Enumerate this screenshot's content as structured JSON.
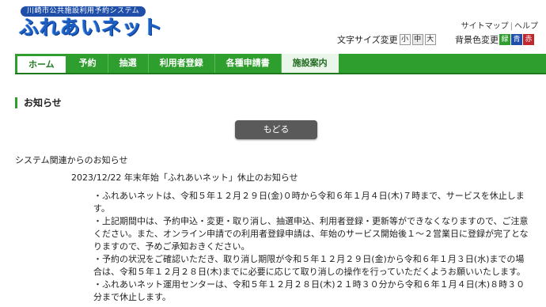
{
  "header": {
    "logo_subtitle": "川崎市公共施設利用予約システム",
    "logo_title": "ふれあいネット",
    "sitemap_link": "サイトマップ",
    "help_link": "ヘルプ",
    "fontsize_label": "文字サイズ変更",
    "fontsize_options": [
      "小",
      "中",
      "大"
    ],
    "bgcolor_label": "背景色変更",
    "bgcolor_options": [
      {
        "label": "緑",
        "color": "#2e9e2e"
      },
      {
        "label": "青",
        "color": "#1f4fa8"
      },
      {
        "label": "赤",
        "color": "#c0272d"
      }
    ]
  },
  "nav": {
    "items": [
      "ホーム",
      "予約",
      "抽選",
      "利用者登録",
      "各種申請書",
      "施設案内"
    ]
  },
  "main": {
    "section_title": "お知らせ",
    "back_button": "もどる",
    "category": "システム関連からのお知らせ",
    "notice_title": "2023/12/22 年末年始「ふれあいネット」休止のお知らせ",
    "notice_lines": [
      "・ふれあいネットは、令和５年１２月２９日(金)０時から令和６年１月４日(木)７時まで、サービスを休止しま",
      "す。",
      "・上記期間中は、予約申込・変更・取り消し、抽選申込、利用者登録・更新等ができなくなりますので、ご注意",
      "ください。また、オンライン申請での利用者登録申請は、年始のサービス開始後１～２営業日に登録が完了とな",
      "りますので、予めご承知おきください。",
      "・予約の状況をご確認いただき、取り消し期限が令和５年１２月２９日(金)から令和６年１月３日(水)までの場",
      "合は、令和５年１２月２８日(木)までに必要に応じて取り消しの操作を行っていただくようお願いいたします。",
      "・ふれあいネット運用センターは、令和５年１２月２８日(木)２１時３０分から令和６年１月４日(木)８時３０",
      "分まで休止します。"
    ]
  }
}
